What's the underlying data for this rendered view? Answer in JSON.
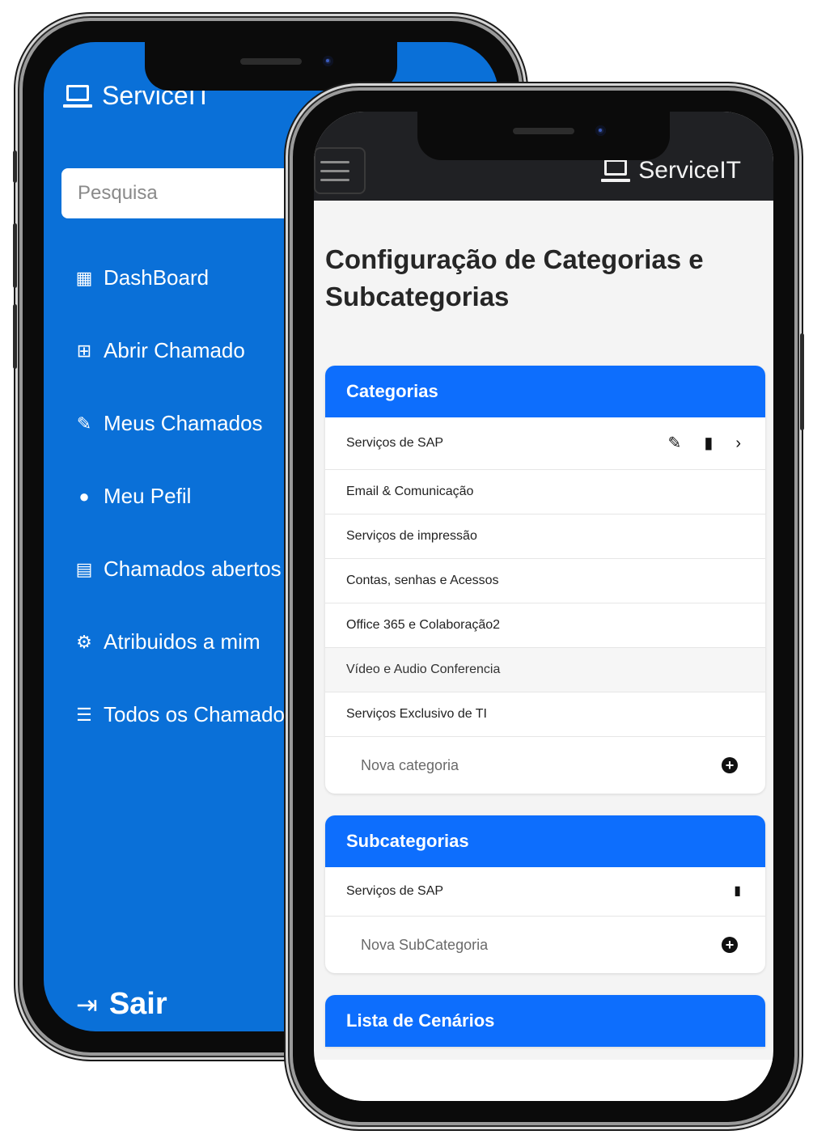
{
  "sidebar": {
    "brand": "ServiceIT",
    "search_placeholder": "Pesquisa",
    "items": [
      {
        "label": "DashBoard",
        "icon": "dashboard-icon"
      },
      {
        "label": "Abrir Chamado",
        "icon": "add-ticket-icon"
      },
      {
        "label": "Meus Chamados",
        "icon": "user-edit-icon"
      },
      {
        "label": "Meu Pefil",
        "icon": "user-icon"
      },
      {
        "label": "Chamados abertos",
        "icon": "clipboard-icon"
      },
      {
        "label": "Atribuidos a mim",
        "icon": "user-cog-icon"
      },
      {
        "label": "Todos os Chamados",
        "icon": "list-icon"
      }
    ],
    "logout_label": "Sair"
  },
  "header": {
    "brand": "ServiceIT"
  },
  "page": {
    "title": "Configuração de Categorias e Subcategorias"
  },
  "categories": {
    "title": "Categorias",
    "items": [
      "Serviços de SAP",
      "Email & Comunicação",
      "Serviços de impressão",
      "Contas, senhas e Acessos",
      "Office 365 e Colaboração2",
      "Vídeo e Audio Conferencia",
      "Serviços Exclusivo de TI"
    ],
    "new_placeholder": "Nova categoria"
  },
  "subcategories": {
    "title": "Subcategorias",
    "items": [
      "Serviços de SAP"
    ],
    "new_placeholder": "Nova SubCategoria"
  },
  "scenarios": {
    "title": "Lista de Cenários"
  },
  "colors": {
    "sidebar_bg": "#0a70d8",
    "card_header": "#0d6efd",
    "topbar_bg": "#202124"
  }
}
